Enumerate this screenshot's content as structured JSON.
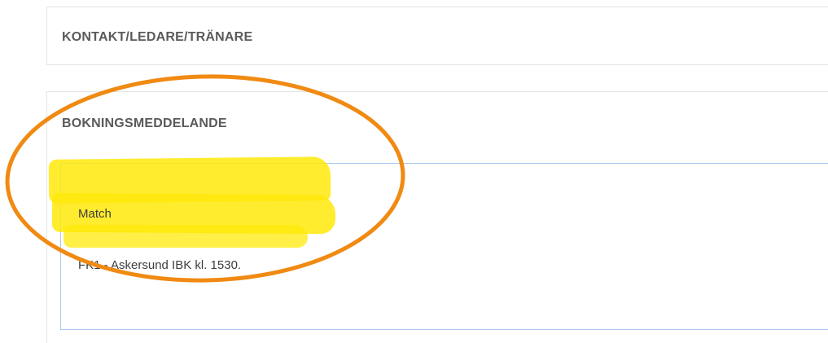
{
  "sections": {
    "contact": {
      "title": "KONTAKT/LEDARE/TRÄNARE"
    },
    "booking_message": {
      "title": "BOKNINGSMEDDELANDE",
      "line1": "Match",
      "line2": "FK1 - Askersund IBK kl. 1530."
    }
  },
  "annotations": {
    "highlight_color": "#ffe90a",
    "circle_color": "#f08a12"
  }
}
